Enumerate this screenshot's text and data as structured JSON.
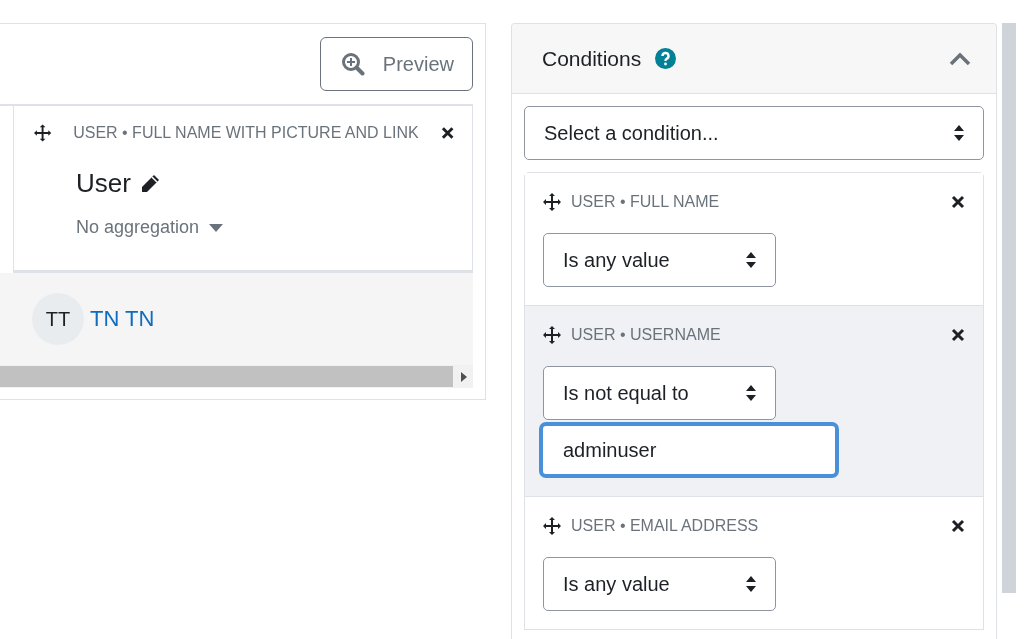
{
  "preview_button": {
    "label": "Preview"
  },
  "column": {
    "title": "USER • FULL NAME WITH PICTURE AND LINK",
    "heading": "User",
    "aggregation": "No aggregation"
  },
  "rows": [
    {
      "initials": "TT",
      "name": "TN TN"
    }
  ],
  "conditions_panel": {
    "title": "Conditions",
    "expanded": true,
    "select": {
      "value": "Select a condition..."
    },
    "conditions": [
      {
        "title": "USER • FULL NAME",
        "operator": "Is any value",
        "selected": false
      },
      {
        "title": "USER • USERNAME",
        "operator": "Is not equal to",
        "value": "adminuser",
        "focused": true,
        "selected": true
      },
      {
        "title": "USER • EMAIL ADDRESS",
        "operator": "Is any value",
        "selected": false
      }
    ]
  }
}
